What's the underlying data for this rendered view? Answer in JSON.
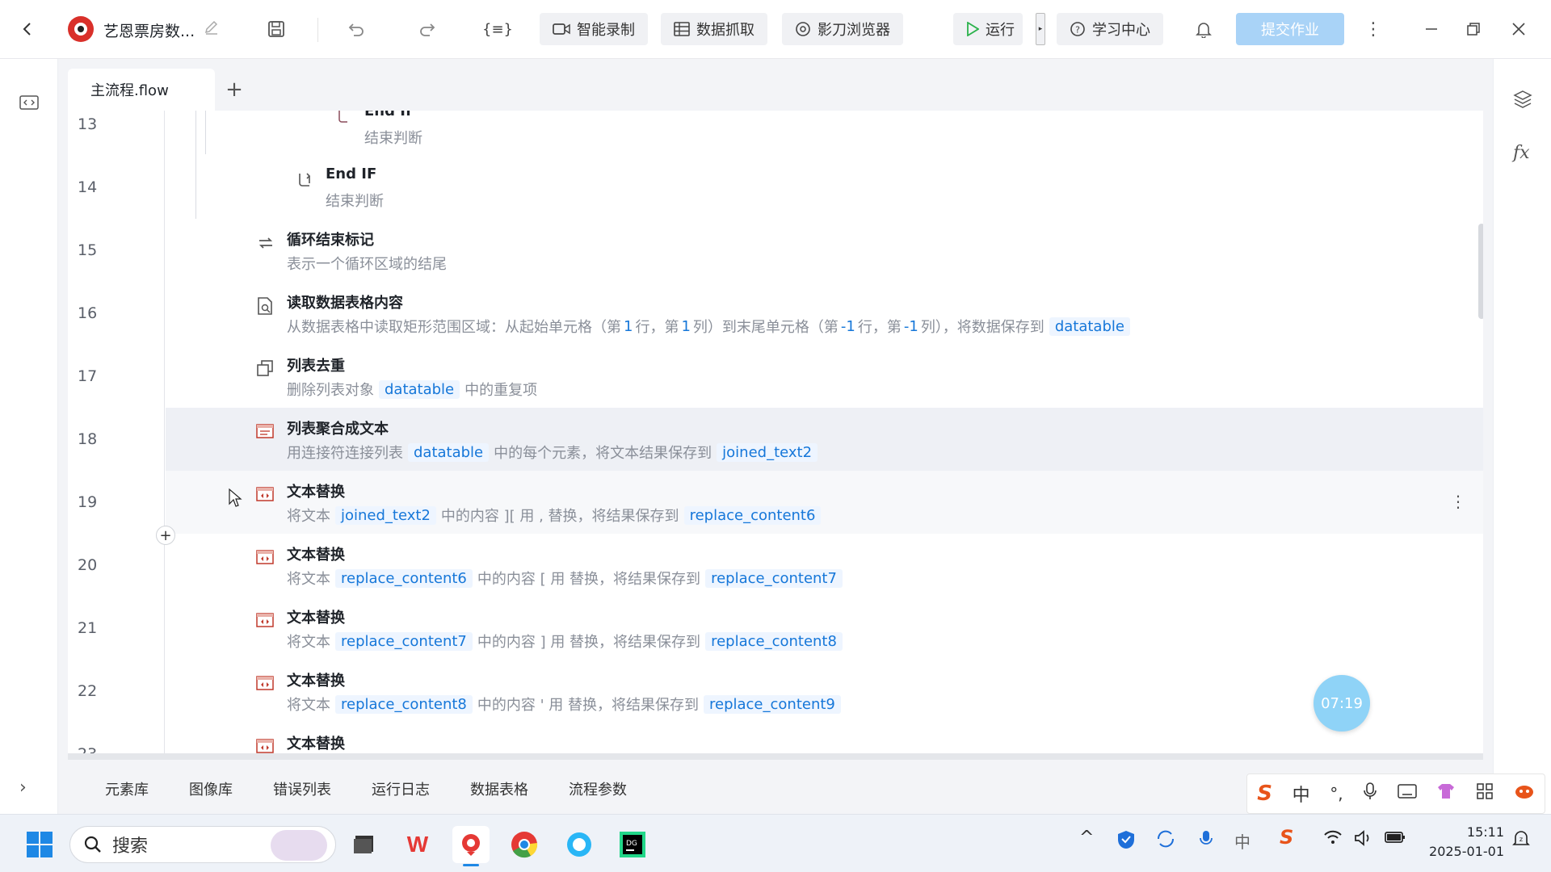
{
  "titlebar": {
    "project_name": "艺恩票房数...",
    "smart_record": "智能录制",
    "data_capture": "数据抓取",
    "browser": "影刀浏览器",
    "run": "运行",
    "learning_center": "学习中心",
    "submit": "提交作业"
  },
  "tabs": {
    "main_flow": "主流程.flow",
    "add": "+"
  },
  "flow": {
    "rows": [
      {
        "line": "13",
        "title": "End If",
        "desc": "结束判断"
      },
      {
        "line": "14",
        "title": "End IF",
        "desc": "结束判断"
      },
      {
        "line": "15",
        "title": "循环结束标记",
        "desc": "表示一个循环区域的结尾"
      },
      {
        "line": "16",
        "title": "读取数据表格内容",
        "desc_a": "从数据表格中读取矩形范围区域：从起始单元格（第",
        "n1": "1",
        "desc_b": "行，第",
        "n2": "1",
        "desc_c": "列）到末尾单元格（第",
        "n3": "-1",
        "desc_d": "行，第",
        "n4": "-1",
        "desc_e": "列），将数据保存到",
        "var1": "datatable"
      },
      {
        "line": "17",
        "title": "列表去重",
        "desc_a": "删除列表对象",
        "var1": "datatable",
        "desc_b": "中的重复项"
      },
      {
        "line": "18",
        "title": "列表聚合成文本",
        "desc_a": "用连接符连接列表",
        "var1": "datatable",
        "desc_b": "中的每个元素，将文本结果保存到",
        "var2": "joined_text2"
      },
      {
        "line": "19",
        "title": "文本替换",
        "desc_a": "将文本",
        "var1": "joined_text2",
        "desc_b": "中的内容 ][ 用 , 替换，将结果保存到",
        "var2": "replace_content6"
      },
      {
        "line": "20",
        "title": "文本替换",
        "desc_a": "将文本",
        "var1": "replace_content6",
        "desc_b": "中的内容 [ 用 替换，将结果保存到",
        "var2": "replace_content7"
      },
      {
        "line": "21",
        "title": "文本替换",
        "desc_a": "将文本",
        "var1": "replace_content7",
        "desc_b": "中的内容 ] 用 替换，将结果保存到",
        "var2": "replace_content8"
      },
      {
        "line": "22",
        "title": "文本替换",
        "desc_a": "将文本",
        "var1": "replace_content8",
        "desc_b": "中的内容 ' 用 替换，将结果保存到",
        "var2": "replace_content9"
      },
      {
        "line": "23",
        "title": "文本替换"
      }
    ]
  },
  "bottom_tabs": [
    "元素库",
    "图像库",
    "错误列表",
    "运行日志",
    "数据表格",
    "流程参数"
  ],
  "timer": "07:19",
  "ime": {
    "lang": "中"
  },
  "taskbar": {
    "search_placeholder": "搜索",
    "time": "15:11",
    "date": "2025-01-01"
  },
  "colors": {
    "accent": "#1677d9",
    "chip_bg": "#eef5ff",
    "submit_bg": "#a9d3f7",
    "run_green": "#2bb24c"
  }
}
